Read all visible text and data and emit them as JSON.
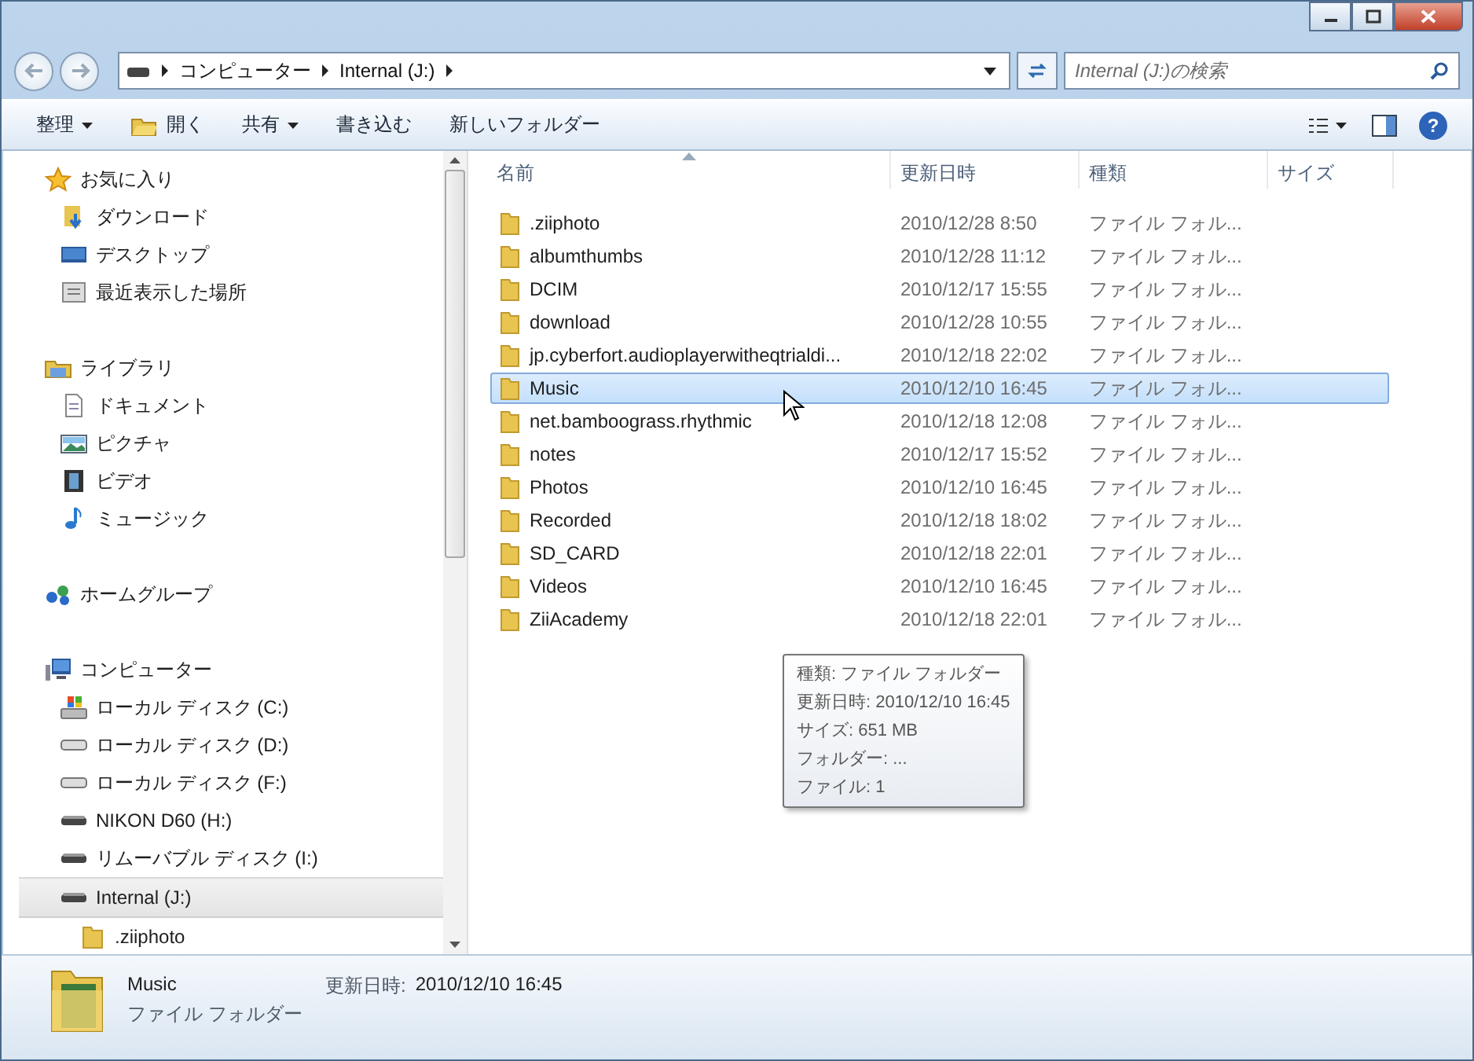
{
  "address": {
    "crumbs": [
      "コンピューター",
      "Internal (J:)"
    ]
  },
  "search": {
    "placeholder": "Internal (J:)の検索"
  },
  "toolbar": [
    {
      "label": "整理",
      "kind": "menu"
    },
    {
      "label": "開く",
      "kind": "open"
    },
    {
      "label": "共有",
      "kind": "menu"
    },
    {
      "label": "書き込む",
      "kind": "plain"
    },
    {
      "label": "新しいフォルダー",
      "kind": "plain"
    }
  ],
  "nav": [
    {
      "label": "お気に入り",
      "kind": "star",
      "selected": false,
      "children": [
        {
          "label": "ダウンロード",
          "kind": "download",
          "selected": false
        },
        {
          "label": "デスクトップ",
          "kind": "desktop",
          "selected": false
        },
        {
          "label": "最近表示した場所",
          "kind": "recent",
          "selected": false
        }
      ]
    },
    {
      "label": "ライブラリ",
      "kind": "library",
      "selected": false,
      "children": [
        {
          "label": "ドキュメント",
          "kind": "document",
          "selected": false
        },
        {
          "label": "ピクチャ",
          "kind": "picture",
          "selected": false
        },
        {
          "label": "ビデオ",
          "kind": "video",
          "selected": false
        },
        {
          "label": "ミュージック",
          "kind": "music",
          "selected": false
        }
      ]
    },
    {
      "label": "ホームグループ",
      "kind": "homegroup",
      "selected": false
    },
    {
      "label": "コンピューター",
      "kind": "computer",
      "selected": false,
      "children": [
        {
          "label": "ローカル ディスク (C:)",
          "kind": "sysdisk",
          "selected": false
        },
        {
          "label": "ローカル ディスク (D:)",
          "kind": "disk",
          "selected": false
        },
        {
          "label": "ローカル ディスク (F:)",
          "kind": "disk",
          "selected": false
        },
        {
          "label": "NIKON D60 (H:)",
          "kind": "removable",
          "selected": false
        },
        {
          "label": "リムーバブル ディスク (I:)",
          "kind": "removable",
          "selected": false
        },
        {
          "label": "Internal (J:)",
          "kind": "removable",
          "selected": true,
          "children": [
            {
              "label": ".ziiphoto",
              "kind": "folder",
              "selected": false
            }
          ]
        }
      ]
    }
  ],
  "table": {
    "columns": [
      "名前",
      "更新日時",
      "種類",
      "サイズ"
    ],
    "rows": [
      {
        "name": ".ziiphoto",
        "date": "2010/12/28 8:50",
        "type": "ファイル フォル...",
        "selected": false
      },
      {
        "name": "albumthumbs",
        "date": "2010/12/28 11:12",
        "type": "ファイル フォル...",
        "selected": false
      },
      {
        "name": "DCIM",
        "date": "2010/12/17 15:55",
        "type": "ファイル フォル...",
        "selected": false
      },
      {
        "name": "download",
        "date": "2010/12/28 10:55",
        "type": "ファイル フォル...",
        "selected": false
      },
      {
        "name": "jp.cyberfort.audioplayerwitheqtrialdi...",
        "date": "2010/12/18 22:02",
        "type": "ファイル フォル...",
        "selected": false
      },
      {
        "name": "Music",
        "date": "2010/12/10 16:45",
        "type": "ファイル フォル...",
        "selected": true
      },
      {
        "name": "net.bamboograss.rhythmic",
        "date": "2010/12/18 12:08",
        "type": "ファイル フォル...",
        "selected": false
      },
      {
        "name": "notes",
        "date": "2010/12/17 15:52",
        "type": "ファイル フォル...",
        "selected": false
      },
      {
        "name": "Photos",
        "date": "2010/12/10 16:45",
        "type": "ファイル フォル...",
        "selected": false
      },
      {
        "name": "Recorded",
        "date": "2010/12/18 18:02",
        "type": "ファイル フォル...",
        "selected": false
      },
      {
        "name": "SD_CARD",
        "date": "2010/12/18 22:01",
        "type": "ファイル フォル...",
        "selected": false
      },
      {
        "name": "Videos",
        "date": "2010/12/10 16:45",
        "type": "ファイル フォル...",
        "selected": false
      },
      {
        "name": "ZiiAcademy",
        "date": "2010/12/18 22:01",
        "type": "ファイル フォル...",
        "selected": false
      }
    ]
  },
  "help": {
    "label": "?"
  },
  "tooltip": [
    "種類: ファイル フォルダー",
    "更新日時: 2010/12/10 16:45",
    "サイズ: 651 MB",
    "フォルダー: ...",
    "ファイル: 1"
  ],
  "details": {
    "name": "Music",
    "type": "ファイル フォルダー",
    "date_label": "更新日時:",
    "date": "2010/12/10 16:45"
  }
}
